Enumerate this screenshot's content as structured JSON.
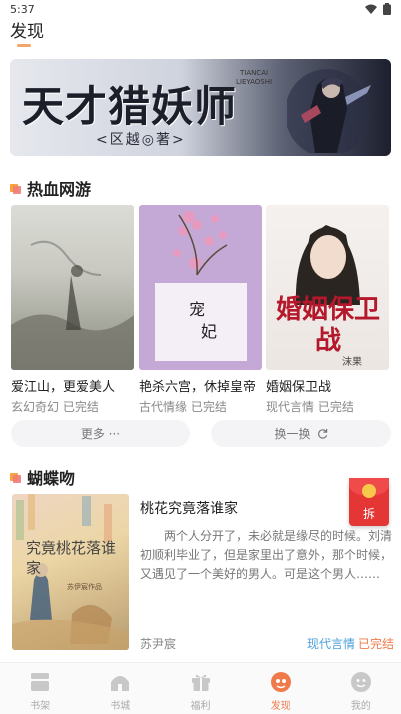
{
  "status_bar": {
    "time": "5:37"
  },
  "header": {
    "title": "发现"
  },
  "banner": {
    "title": "天才猎妖师",
    "author": "<区越◎著>",
    "subtitle_line1": "TIANCAI",
    "subtitle_line2": "LIEYAOSHI"
  },
  "section1": {
    "title": "热血网游",
    "books": [
      {
        "name": "爱江山，更爱美人",
        "category": "玄幻奇幻",
        "status": "已完结"
      },
      {
        "name": "艳杀六宫，休掉皇帝",
        "category": "古代情缘",
        "status": "已完结"
      },
      {
        "name": "婚姻保卫战",
        "category": "现代言情",
        "status": "已完结",
        "cover_text": "婚姻保卫战",
        "cover_author": "沫果"
      }
    ],
    "more_label": "更多 ···",
    "refresh_label": "换一换"
  },
  "section2": {
    "title": "蝴蝶吻",
    "feature": {
      "cover_title": "究竟桃花落谁家",
      "cover_author": "苏伊宸作品",
      "name": "桃花究竟落谁家",
      "description": "两个人分开了，未必就是缘尽的时候。刘清初顺利毕业了，但是家里出了意外，那个时候，又遇见了一个美好的男人。可是这个男人……",
      "author": "苏尹宸",
      "category": "现代言情",
      "status": "已完结"
    }
  },
  "red_packet": {
    "label": "拆"
  },
  "tabbar": {
    "tabs": [
      {
        "label": "书架",
        "icon": "bookshelf-icon"
      },
      {
        "label": "书城",
        "icon": "bookstore-icon"
      },
      {
        "label": "福利",
        "icon": "gift-icon"
      },
      {
        "label": "发现",
        "icon": "discover-icon"
      },
      {
        "label": "我的",
        "icon": "profile-icon"
      }
    ],
    "active_index": 3
  },
  "colors": {
    "accent": "#f07a4a",
    "category": "#4a9fd8",
    "status": "#f07a4a",
    "tab_inactive": "#aaaaaa"
  }
}
